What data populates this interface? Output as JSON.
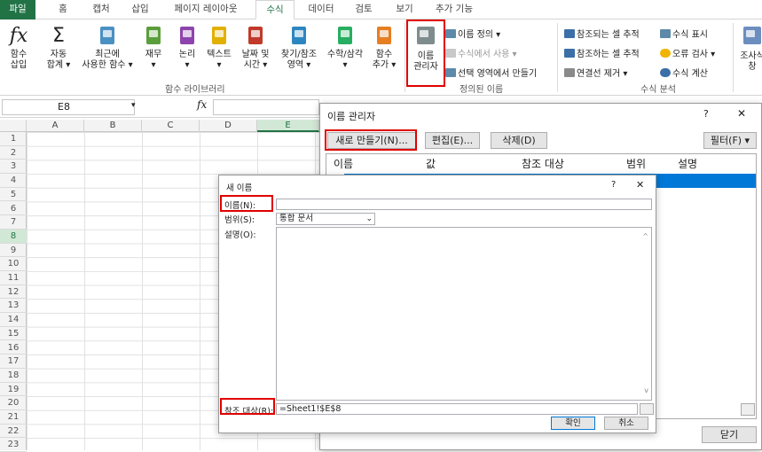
{
  "tabs": [
    "파일",
    "홈",
    "캡처",
    "삽입",
    "페이지 레이아웃",
    "수식",
    "데이터",
    "검토",
    "보기",
    "추가 기능"
  ],
  "ribbon": {
    "insert_fn": [
      "함수",
      "삽입"
    ],
    "autosum": [
      "자동",
      "합계 ▾"
    ],
    "recent": [
      "최근에",
      "사용한 함수 ▾"
    ],
    "finance": [
      "재무",
      "▾"
    ],
    "logic": [
      "논리",
      "▾"
    ],
    "text": [
      "텍스트",
      "▾"
    ],
    "datetime": [
      "날짜 및",
      "시간 ▾"
    ],
    "lookup": [
      "찾기/참조",
      "영역 ▾"
    ],
    "math": [
      "수학/삼각",
      "▾"
    ],
    "more": [
      "함수",
      "추가 ▾"
    ],
    "group_library": "함수 라이브러리",
    "name_mgr": [
      "이름",
      "관리자"
    ],
    "define_name": "이름 정의 ▾",
    "use_in_formula": "수식에서 사용 ▾",
    "create_from_sel": "선택 영역에서 만들기",
    "group_defined": "정의된 이름",
    "trace_prec": "참조되는 셀 추적",
    "trace_dep": "참조하는 셀 추적",
    "remove_arrows": "연결선 제거 ▾",
    "show_formulas": "수식 표시",
    "error_check": "오류 검사 ▾",
    "eval_formula": "수식 계산",
    "group_audit": "수식 분석",
    "watch": [
      "조사식",
      "창"
    ],
    "fx_glyph": "fx",
    "sigma_glyph": "Σ"
  },
  "formula_bar": {
    "cell": "E8",
    "dropdown": "▾",
    "fx": "fx"
  },
  "columns": [
    "A",
    "B",
    "C",
    "D",
    "E"
  ],
  "rows": [
    "1",
    "2",
    "3",
    "4",
    "5",
    "6",
    "7",
    "8",
    "9",
    "10",
    "11",
    "12",
    "13",
    "14",
    "15",
    "16",
    "17",
    "18",
    "19",
    "20",
    "21",
    "22",
    "23"
  ],
  "name_manager": {
    "title": "이름 관리자",
    "help": "?",
    "close": "✕",
    "new_btn": "새로 만들기(N)...",
    "edit_btn": "편집(E)...",
    "delete_btn": "삭제(D)",
    "filter_btn": "필터(F) ▾",
    "headers": [
      "이름",
      "값",
      "참조 대상",
      "범위",
      "설명"
    ],
    "close_btn": "닫기",
    "scroll_right": ">"
  },
  "new_name": {
    "title": "새 이름",
    "help": "?",
    "close": "✕",
    "name_label": "이름(N):",
    "scope_label": "범위(S):",
    "scope_value": "통합 문서",
    "comment_label": "설명(O):",
    "ref_label": "참조 대상(R):",
    "ref_value": "=Sheet1!$E$8",
    "ok": "확인",
    "cancel": "취소",
    "scroll_up": "^",
    "scroll_down": "v",
    "combo_arrow": "⌄"
  },
  "colors": {
    "accent": "#217346",
    "highlight": "#e00000",
    "selection": "#0078d7"
  }
}
